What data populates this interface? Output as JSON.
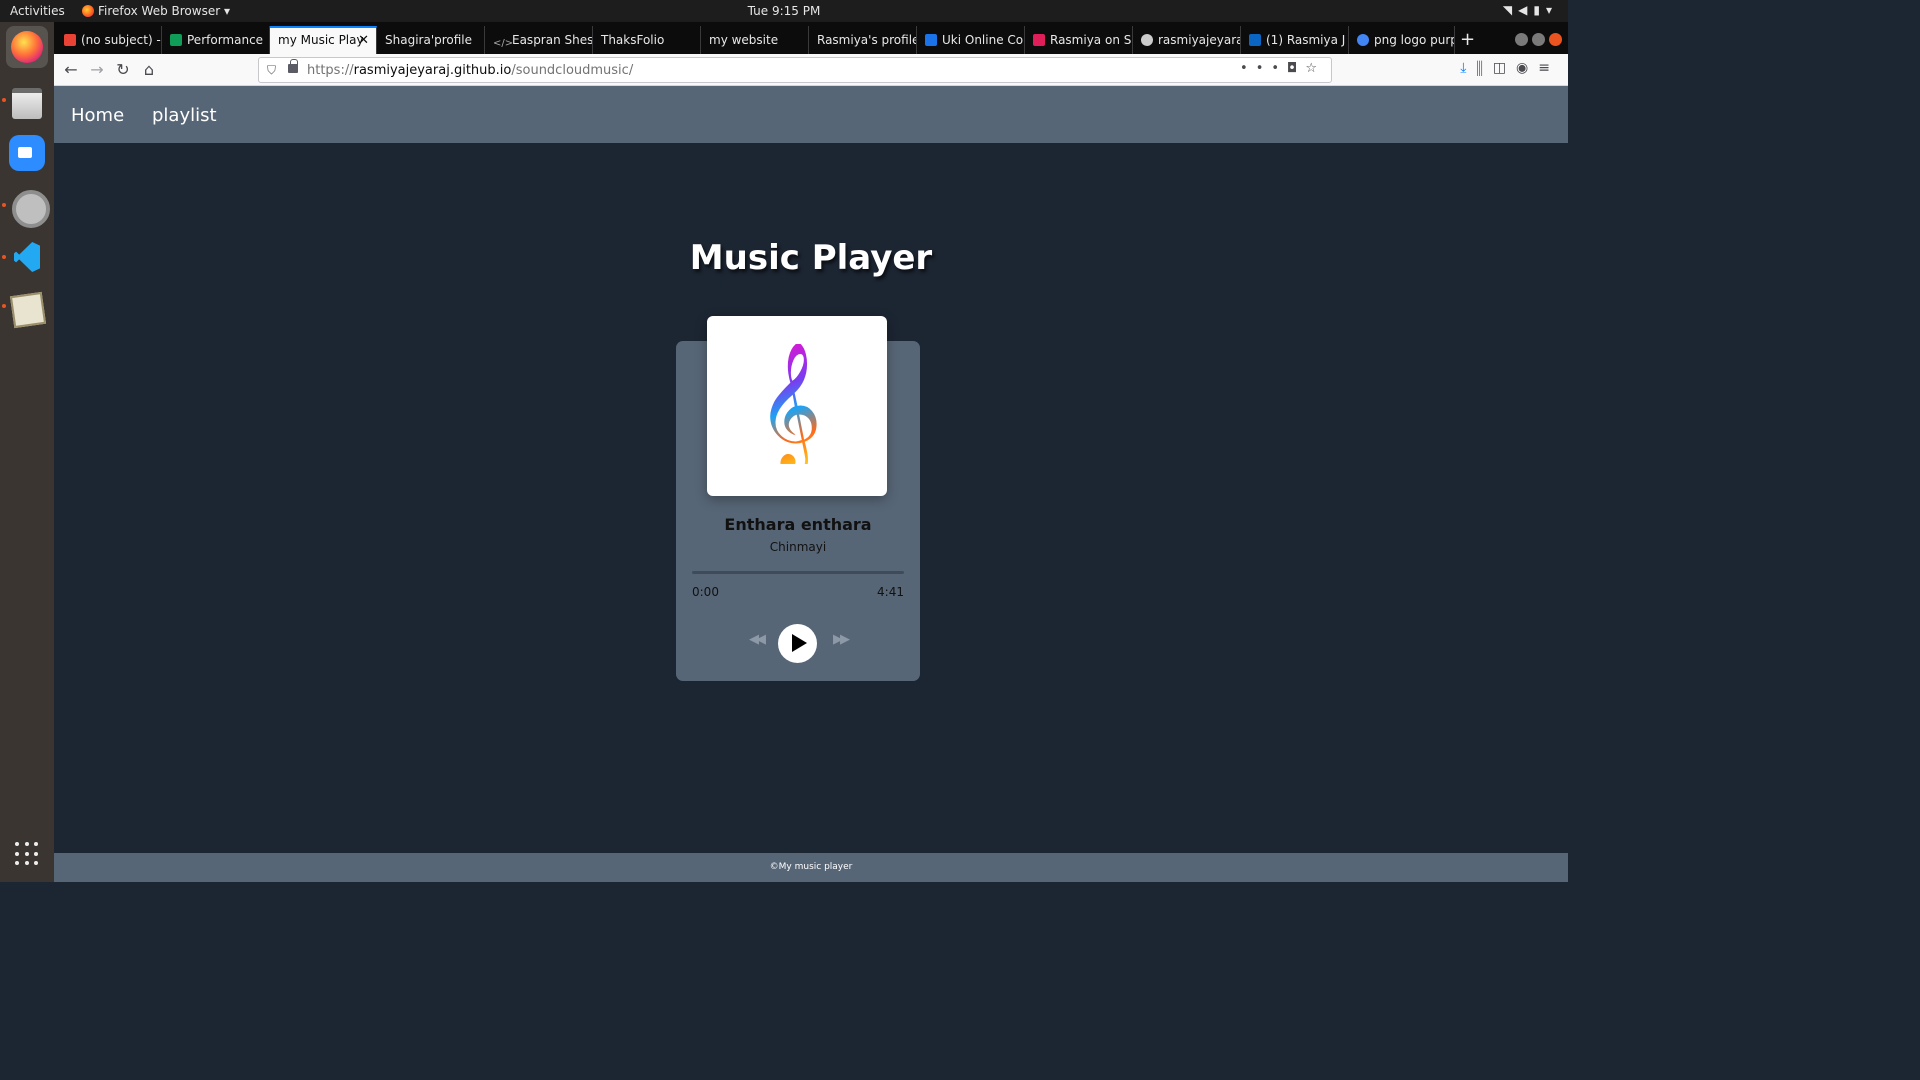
{
  "system": {
    "activities": "Activities",
    "app_menu": "Firefox Web Browser ▾",
    "clock": "Tue  9:15 PM"
  },
  "browser": {
    "tabs": [
      {
        "label": "(no subject) -",
        "icon": "gmail-icon",
        "color": "#ea4335"
      },
      {
        "label": "Performance",
        "icon": "sheets-icon",
        "color": "#0f9d58"
      },
      {
        "label": "my Music Play",
        "icon": "",
        "color": "",
        "active": true
      },
      {
        "label": "Shagira'profile",
        "icon": "",
        "color": ""
      },
      {
        "label": "Easpran Shes",
        "icon": "code-icon",
        "color": "#888888"
      },
      {
        "label": "ThaksFolio",
        "icon": "",
        "color": ""
      },
      {
        "label": "my website",
        "icon": "",
        "color": ""
      },
      {
        "label": "Rasmiya's profile",
        "icon": "",
        "color": ""
      },
      {
        "label": "Uki Online Co",
        "icon": "contact-icon",
        "color": "#1a73e8"
      },
      {
        "label": "Rasmiya on S",
        "icon": "slack-icon",
        "color": "#e01e5a"
      },
      {
        "label": "rasmiyajeyara",
        "icon": "github-icon",
        "color": "#cccccc"
      },
      {
        "label": "(1) Rasmiya J",
        "icon": "linkedin-icon",
        "color": "#0a66c2"
      },
      {
        "label": "png logo purp",
        "icon": "google-icon",
        "color": "#4285f4"
      }
    ],
    "url_prefix": "https://",
    "url_domain": "rasmiyajeyaraj.github.io",
    "url_path": "/soundcloudmusic/"
  },
  "site": {
    "nav": [
      "Home",
      "playlist"
    ],
    "heading": "Music Player",
    "track": {
      "title": "Enthara enthara",
      "artist": "Chinmayi",
      "current_time": "0:00",
      "duration": "4:41",
      "progress": 0
    },
    "footer": "©My music player"
  },
  "colors": {
    "page_bg": "#1c2532",
    "nav_bg": "#576677",
    "card_bg": "#576677",
    "accent_tab": "#0a84ff"
  }
}
